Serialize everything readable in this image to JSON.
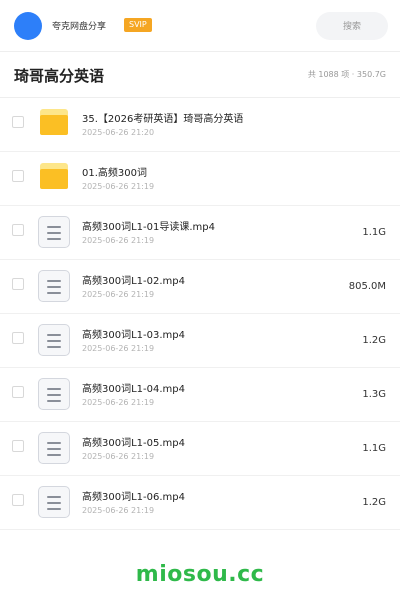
{
  "header": {
    "share_title": "夸克网盘分享",
    "badge": "SVIP",
    "search_label": "搜索"
  },
  "folder": {
    "title": "琦哥高分英语",
    "meta": "共 1088 项 · 350.7G"
  },
  "files": [
    {
      "type": "folder",
      "icon": "folder-icon",
      "name": "35.【2026考研英语】琦哥高分英语",
      "date": "2025-06-26 21:20",
      "size": ""
    },
    {
      "type": "folder",
      "icon": "folder-icon",
      "name": "01.高频300词",
      "date": "2025-06-26 21:19",
      "size": ""
    },
    {
      "type": "file",
      "icon": "video-file-icon",
      "name": "高频300词L1-01导读课.mp4",
      "date": "2025-06-26 21:19",
      "size": "1.1G"
    },
    {
      "type": "file",
      "icon": "video-file-icon",
      "name": "高频300词L1-02.mp4",
      "date": "2025-06-26 21:19",
      "size": "805.0M"
    },
    {
      "type": "file",
      "icon": "video-file-icon",
      "name": "高频300词L1-03.mp4",
      "date": "2025-06-26 21:19",
      "size": "1.2G"
    },
    {
      "type": "file",
      "icon": "video-file-icon",
      "name": "高频300词L1-04.mp4",
      "date": "2025-06-26 21:19",
      "size": "1.3G"
    },
    {
      "type": "file",
      "icon": "video-file-icon",
      "name": "高频300词L1-05.mp4",
      "date": "2025-06-26 21:19",
      "size": "1.1G"
    },
    {
      "type": "file",
      "icon": "video-file-icon",
      "name": "高频300词L1-06.mp4",
      "date": "2025-06-26 21:19",
      "size": "1.2G"
    }
  ],
  "watermark": "miosou.cc",
  "colors": {
    "accent": "#2d7ff9",
    "badge": "#f5a623",
    "folder": "#fbbf24",
    "watermark": "#2fb94a"
  }
}
